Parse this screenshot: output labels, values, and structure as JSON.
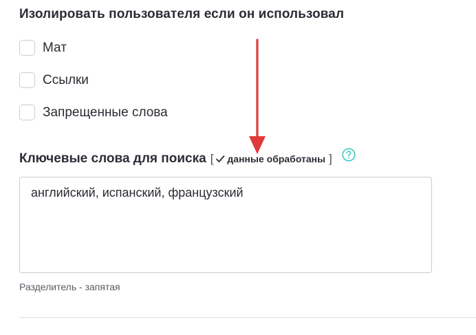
{
  "isolate_section": {
    "title": "Изолировать пользователя если он использовал",
    "options": [
      {
        "label": "Мат",
        "checked": false
      },
      {
        "label": "Ссылки",
        "checked": false
      },
      {
        "label": "Запрещенные слова",
        "checked": false
      }
    ]
  },
  "keywords_section": {
    "title": "Ключевые слова для поиска",
    "bracket_open": "[",
    "status_text": "данные обработаны",
    "bracket_close": "]",
    "help_icon": "question-circle-icon",
    "value": "английский, испанский, французский",
    "hint": "Разделитель - запятая"
  },
  "colors": {
    "help_accent": "#3cc7c0",
    "arrow": "#e0393a",
    "border": "#c9ccd3"
  }
}
